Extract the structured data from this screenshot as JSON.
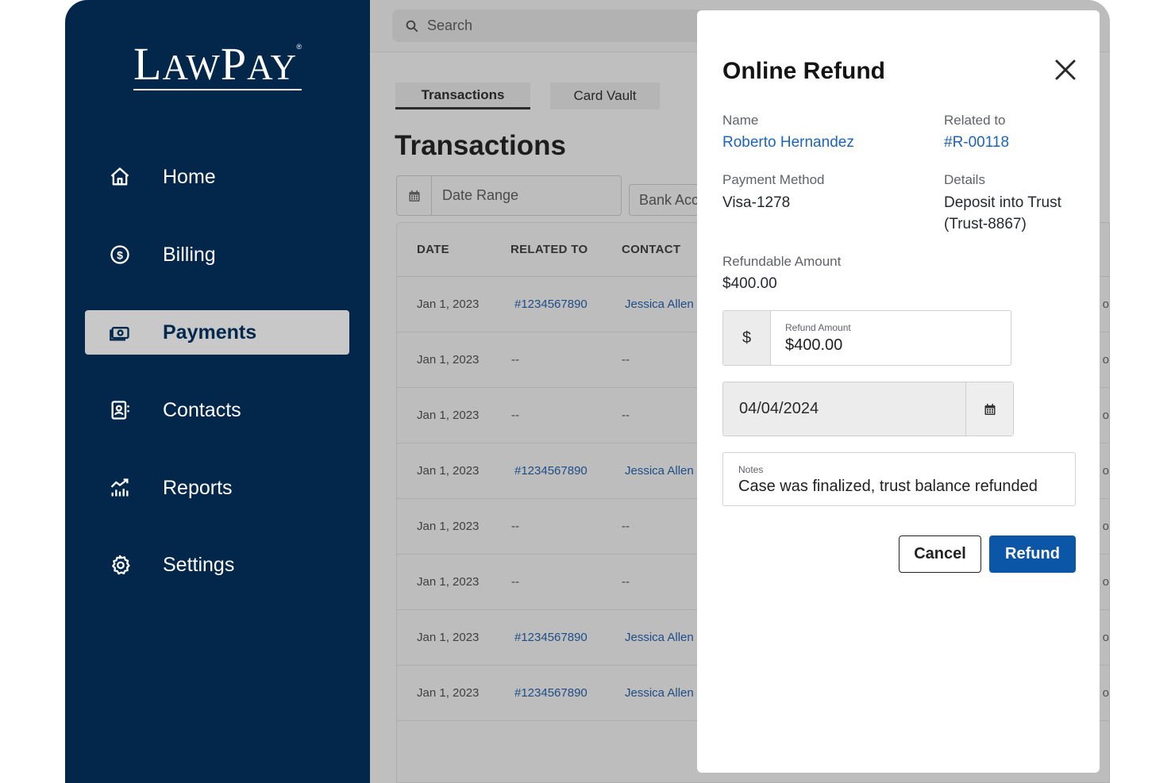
{
  "brand": {
    "logo": "LawPay",
    "logo_first": "L",
    "logo_mid": "AW",
    "logo_p": "P",
    "logo_end": "AY",
    "reg": "®"
  },
  "sidebar": {
    "items": [
      {
        "label": "Home",
        "icon": "home-icon",
        "active": false
      },
      {
        "label": "Billing",
        "icon": "dollar-circle-icon",
        "active": false
      },
      {
        "label": "Payments",
        "icon": "money-icon",
        "active": true
      },
      {
        "label": "Contacts",
        "icon": "contact-card-icon",
        "active": false
      },
      {
        "label": "Reports",
        "icon": "chart-icon",
        "active": false
      },
      {
        "label": "Settings",
        "icon": "gear-icon",
        "active": false
      }
    ]
  },
  "search": {
    "placeholder": "Search"
  },
  "tabs": [
    {
      "label": "Transactions",
      "active": true
    },
    {
      "label": "Card Vault",
      "active": false
    }
  ],
  "page": {
    "title": "Transactions"
  },
  "filters": {
    "date_range": "Date Range",
    "bank": "Bank Acc"
  },
  "table": {
    "headers": [
      "DATE",
      "RELATED TO",
      "CONTACT"
    ],
    "rows": [
      {
        "date": "Jan 1, 2023",
        "related": "#1234567890",
        "contact": "Jessica Allen",
        "tail": "o"
      },
      {
        "date": "Jan 1, 2023",
        "related": "--",
        "contact": "--",
        "tail": "o"
      },
      {
        "date": "Jan 1, 2023",
        "related": "--",
        "contact": "--",
        "tail": "o"
      },
      {
        "date": "Jan 1, 2023",
        "related": "#1234567890",
        "contact": "Jessica Allen",
        "tail": "o"
      },
      {
        "date": "Jan 1, 2023",
        "related": "--",
        "contact": "--",
        "tail": "o"
      },
      {
        "date": "Jan 1, 2023",
        "related": "--",
        "contact": "--",
        "tail": "o"
      },
      {
        "date": "Jan 1, 2023",
        "related": "#1234567890",
        "contact": "Jessica Allen",
        "tail": "o"
      },
      {
        "date": "Jan 1, 2023",
        "related": "#1234567890",
        "contact": "Jessica Allen",
        "tail": "o"
      }
    ]
  },
  "modal": {
    "title": "Online Refund",
    "name_label": "Name",
    "name_value": "Roberto Hernandez",
    "related_label": "Related to",
    "related_value": "#R-00118",
    "method_label": "Payment Method",
    "method_value": "Visa-1278",
    "details_label": "Details",
    "details_line1": "Deposit into Trust",
    "details_line2": "(Trust-8867)",
    "refundable_label": "Refundable Amount",
    "refundable_value": "$400.00",
    "currency_symbol": "$",
    "refund_amount_label": "Refund Amount",
    "refund_amount_value": "$400.00",
    "date_value": "04/04/2024",
    "notes_label": "Notes",
    "notes_value": "Case was finalized, trust balance refunded",
    "cancel_label": "Cancel",
    "refund_label": "Refund"
  },
  "colors": {
    "sidebar": "#02274b",
    "link": "#1b64b8",
    "primary_button": "#0b56a6"
  }
}
